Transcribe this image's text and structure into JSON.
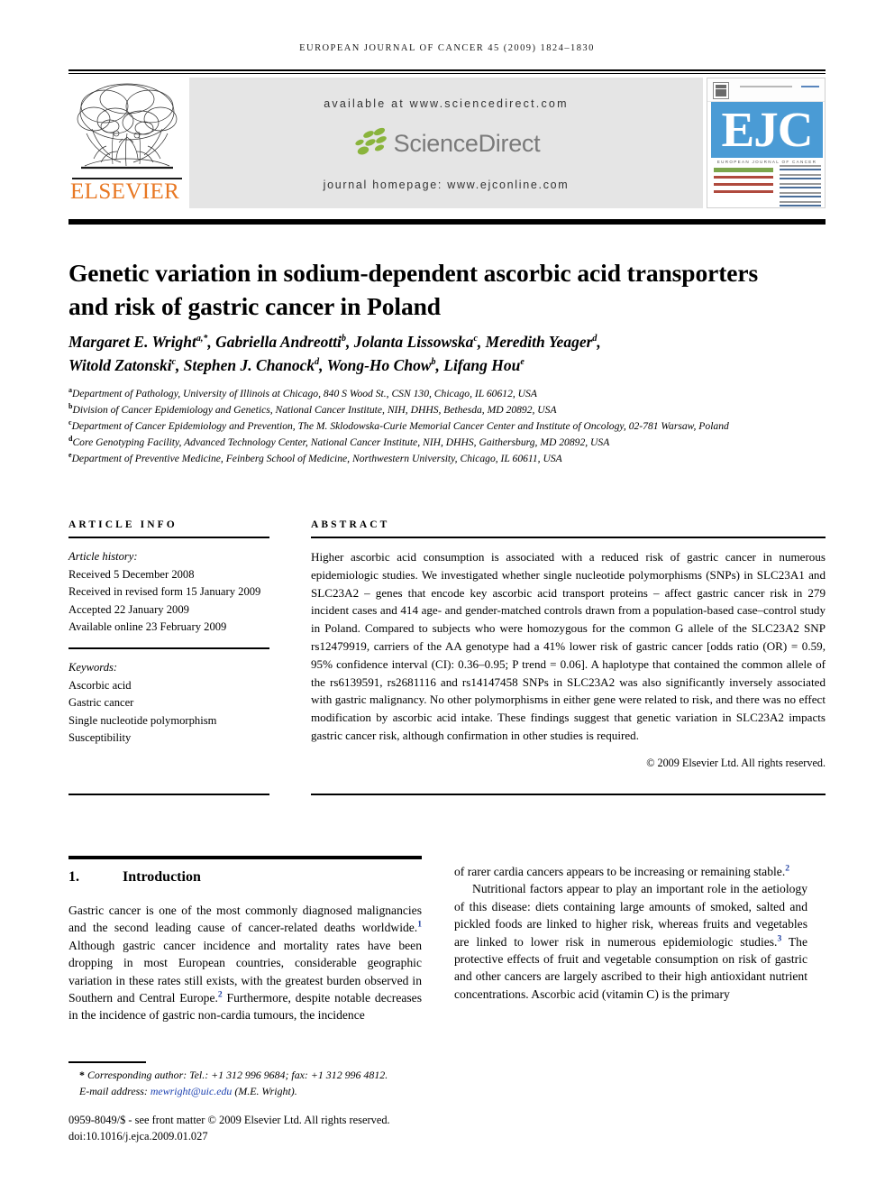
{
  "running_head": "EUROPEAN JOURNAL OF CANCER 45 (2009) 1824–1830",
  "header": {
    "publisher_name": "ELSEVIER",
    "available_at": "available at www.sciencedirect.com",
    "sciencedirect_wordmark": "ScienceDirect",
    "journal_homepage": "journal homepage: www.ejconline.com",
    "cover": {
      "letters": "EJC",
      "subtitle": "EUROPEAN JOURNAL OF CANCER"
    }
  },
  "article": {
    "title": "Genetic variation in sodium-dependent ascorbic acid transporters and risk of gastric cancer in Poland",
    "authors_line1_parts": [
      {
        "name": "Margaret E. Wright",
        "sup": "a,*"
      },
      {
        "name": "Gabriella Andreotti",
        "sup": "b"
      },
      {
        "name": "Jolanta Lissowska",
        "sup": "c"
      },
      {
        "name": "Meredith Yeager",
        "sup": "d"
      }
    ],
    "authors_line2_parts": [
      {
        "name": "Witold Zatonski",
        "sup": "c"
      },
      {
        "name": "Stephen J. Chanock",
        "sup": "d"
      },
      {
        "name": "Wong-Ho Chow",
        "sup": "b"
      },
      {
        "name": "Lifang Hou",
        "sup": "e"
      }
    ],
    "affiliations": [
      {
        "mark": "a",
        "text": "Department of Pathology, University of Illinois at Chicago, 840 S Wood St., CSN 130, Chicago, IL 60612, USA"
      },
      {
        "mark": "b",
        "text": "Division of Cancer Epidemiology and Genetics, National Cancer Institute, NIH, DHHS, Bethesda, MD 20892, USA"
      },
      {
        "mark": "c",
        "text": "Department of Cancer Epidemiology and Prevention, The M. Sklodowska-Curie Memorial Cancer Center and Institute of Oncology, 02-781 Warsaw, Poland"
      },
      {
        "mark": "d",
        "text": "Core Genotyping Facility, Advanced Technology Center, National Cancer Institute, NIH, DHHS, Gaithersburg, MD 20892, USA"
      },
      {
        "mark": "e",
        "text": "Department of Preventive Medicine, Feinberg School of Medicine, Northwestern University, Chicago, IL 60611, USA"
      }
    ]
  },
  "article_info": {
    "heading": "ARTICLE INFO",
    "history_label": "Article history:",
    "history": [
      "Received 5 December 2008",
      "Received in revised form 15 January 2009",
      "Accepted 22 January 2009",
      "Available online 23 February 2009"
    ],
    "keywords_label": "Keywords:",
    "keywords": [
      "Ascorbic acid",
      "Gastric cancer",
      "Single nucleotide polymorphism",
      "Susceptibility"
    ]
  },
  "abstract": {
    "heading": "ABSTRACT",
    "text": "Higher ascorbic acid consumption is associated with a reduced risk of gastric cancer in numerous epidemiologic studies. We investigated whether single nucleotide polymorphisms (SNPs) in SLC23A1 and SLC23A2 – genes that encode key ascorbic acid transport proteins – affect gastric cancer risk in 279 incident cases and 414 age- and gender-matched controls drawn from a population-based case–control study in Poland. Compared to subjects who were homozygous for the common G allele of the SLC23A2 SNP rs12479919, carriers of the AA genotype had a 41% lower risk of gastric cancer [odds ratio (OR) = 0.59, 95% confidence interval (CI): 0.36–0.95; P trend = 0.06]. A haplotype that contained the common allele of the rs6139591, rs2681116 and rs14147458 SNPs in SLC23A2 was also significantly inversely associated with gastric malignancy. No other polymorphisms in either gene were related to risk, and there was no effect modification by ascorbic acid intake. These findings suggest that genetic variation in SLC23A2 impacts gastric cancer risk, although confirmation in other studies is required.",
    "copyright": "© 2009 Elsevier Ltd. All rights reserved."
  },
  "body": {
    "section_number": "1.",
    "section_title": "Introduction",
    "left_paragraph_1_a": "Gastric cancer is one of the most commonly diagnosed malignancies and the second leading cause of cancer-related deaths worldwide.",
    "left_ref_1": "1",
    "left_paragraph_1_b": " Although gastric cancer incidence and mortality rates have been dropping in most European countries, considerable geographic variation in these rates still exists, with the greatest burden observed in Southern and Central Europe.",
    "left_ref_2": "2",
    "left_paragraph_1_c": " Furthermore, despite notable decreases in the incidence of gastric non-cardia tumours, the incidence",
    "right_paragraph_1_a": "of rarer cardia cancers appears to be increasing or remaining stable.",
    "right_ref_2": "2",
    "right_paragraph_2_a": "Nutritional factors appear to play an important role in the aetiology of this disease: diets containing large amounts of smoked, salted and pickled foods are linked to higher risk, whereas fruits and vegetables are linked to lower risk in numerous epidemiologic studies.",
    "right_ref_3": "3",
    "right_paragraph_2_b": " The protective effects of fruit and vegetable consumption on risk of gastric and other cancers are largely ascribed to their high antioxidant nutrient concentrations. Ascorbic acid (vitamin C) is the primary"
  },
  "footnotes": {
    "star": "*",
    "corresponding": "Corresponding author: Tel.: +1 312 996 9684; fax: +1 312 996 4812.",
    "email_label": "E-mail address:",
    "email": "mewright@uic.edu",
    "email_owner": "(M.E. Wright).",
    "issn_line": "0959-8049/$ - see front matter © 2009 Elsevier Ltd. All rights reserved.",
    "doi_line": "doi:10.1016/j.ejca.2009.01.027"
  },
  "colors": {
    "elsevier_orange": "#E87722",
    "sciencedirect_grey": "#7a7a7a",
    "sciencedirect_leaf_green": "#8ab43c",
    "ejc_blue": "#4a9bd5",
    "reference_blue": "#1f3fa0",
    "link_blue": "#1a3fb0",
    "band_grey": "#e5e5e5"
  }
}
